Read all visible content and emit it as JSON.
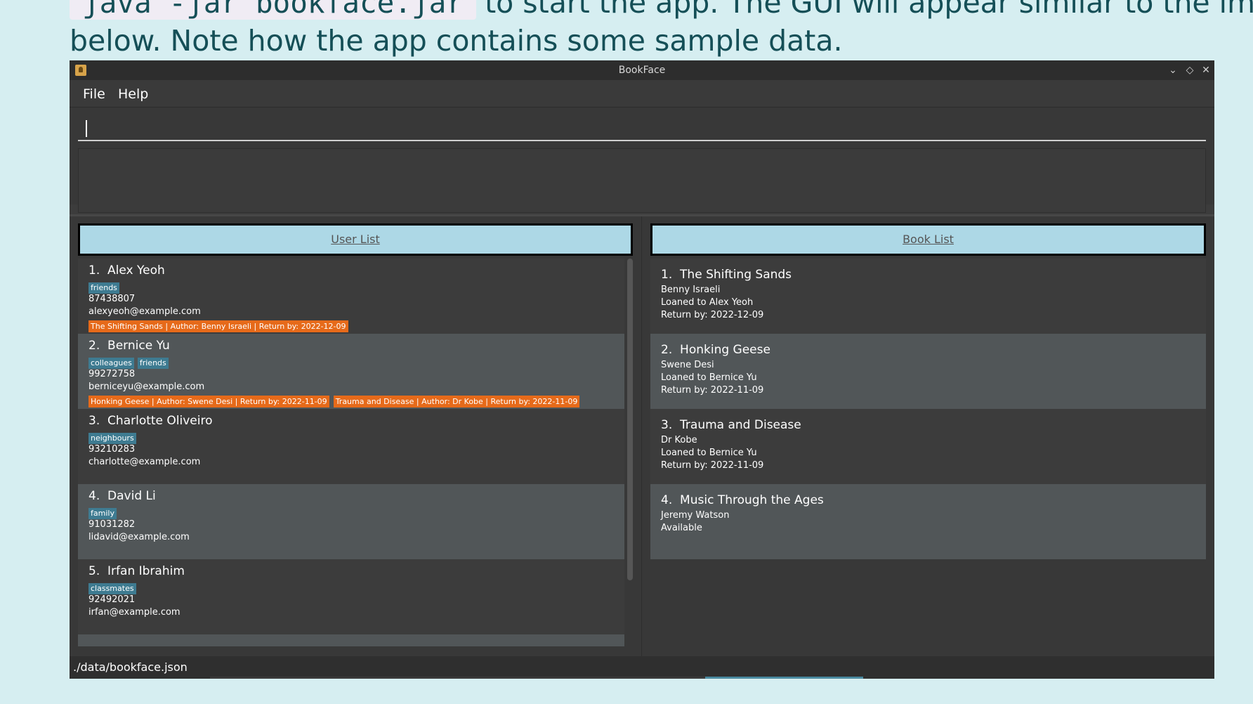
{
  "doc": {
    "code_chip": "java -jar bookface.jar",
    "line1_rest": "to start the app. The GUI will appear similar to the image",
    "line2": "below. Note how the app contains some sample data."
  },
  "window": {
    "title": "BookFace",
    "controls": [
      "⌄",
      "◇",
      "✕"
    ]
  },
  "menu": {
    "file": "File",
    "help": "Help"
  },
  "command": {
    "value": "",
    "placeholder": ""
  },
  "result": {
    "text": ""
  },
  "user_list": {
    "header": "User List",
    "users": [
      {
        "index": "1.",
        "name": "Alex Yeoh",
        "tags": [
          "friends"
        ],
        "phone": "87438807",
        "email": "alexyeoh@example.com",
        "loans": [
          "The Shifting Sands | Author: Benny Israeli | Return by: 2022-12-09"
        ]
      },
      {
        "index": "2.",
        "name": "Bernice Yu",
        "tags": [
          "colleagues",
          "friends"
        ],
        "phone": "99272758",
        "email": "berniceyu@example.com",
        "loans": [
          "Honking Geese | Author: Swene Desi | Return by: 2022-11-09",
          "Trauma and Disease | Author: Dr Kobe | Return by: 2022-11-09"
        ]
      },
      {
        "index": "3.",
        "name": "Charlotte Oliveiro",
        "tags": [
          "neighbours"
        ],
        "phone": "93210283",
        "email": "charlotte@example.com",
        "loans": []
      },
      {
        "index": "4.",
        "name": "David Li",
        "tags": [
          "family"
        ],
        "phone": "91031282",
        "email": "lidavid@example.com",
        "loans": []
      },
      {
        "index": "5.",
        "name": "Irfan Ibrahim",
        "tags": [
          "classmates"
        ],
        "phone": "92492021",
        "email": "irfan@example.com",
        "loans": []
      }
    ]
  },
  "book_list": {
    "header": "Book List",
    "books": [
      {
        "index": "1.",
        "title": "The Shifting Sands",
        "author": "Benny Israeli",
        "status": "Loaned to Alex Yeoh",
        "return": "Return by: 2022-12-09"
      },
      {
        "index": "2.",
        "title": "Honking Geese",
        "author": "Swene Desi",
        "status": "Loaned to Bernice Yu",
        "return": "Return by: 2022-11-09"
      },
      {
        "index": "3.",
        "title": "Trauma and Disease",
        "author": "Dr Kobe",
        "status": "Loaned to Bernice Yu",
        "return": "Return by: 2022-11-09"
      },
      {
        "index": "4.",
        "title": "Music Through the Ages",
        "author": "Jeremy Watson",
        "status": "Available",
        "return": ""
      }
    ]
  },
  "status_bar": {
    "path": "./data/bookface.json"
  },
  "colors": {
    "page_bg": "#d6eef1",
    "doc_text": "#154f57",
    "header_bg": "#add8e6",
    "tag_bg": "#3e7b91",
    "loan_tag_bg": "#e66a1a",
    "card_even": "#3c3c3c",
    "card_odd": "#515658"
  }
}
